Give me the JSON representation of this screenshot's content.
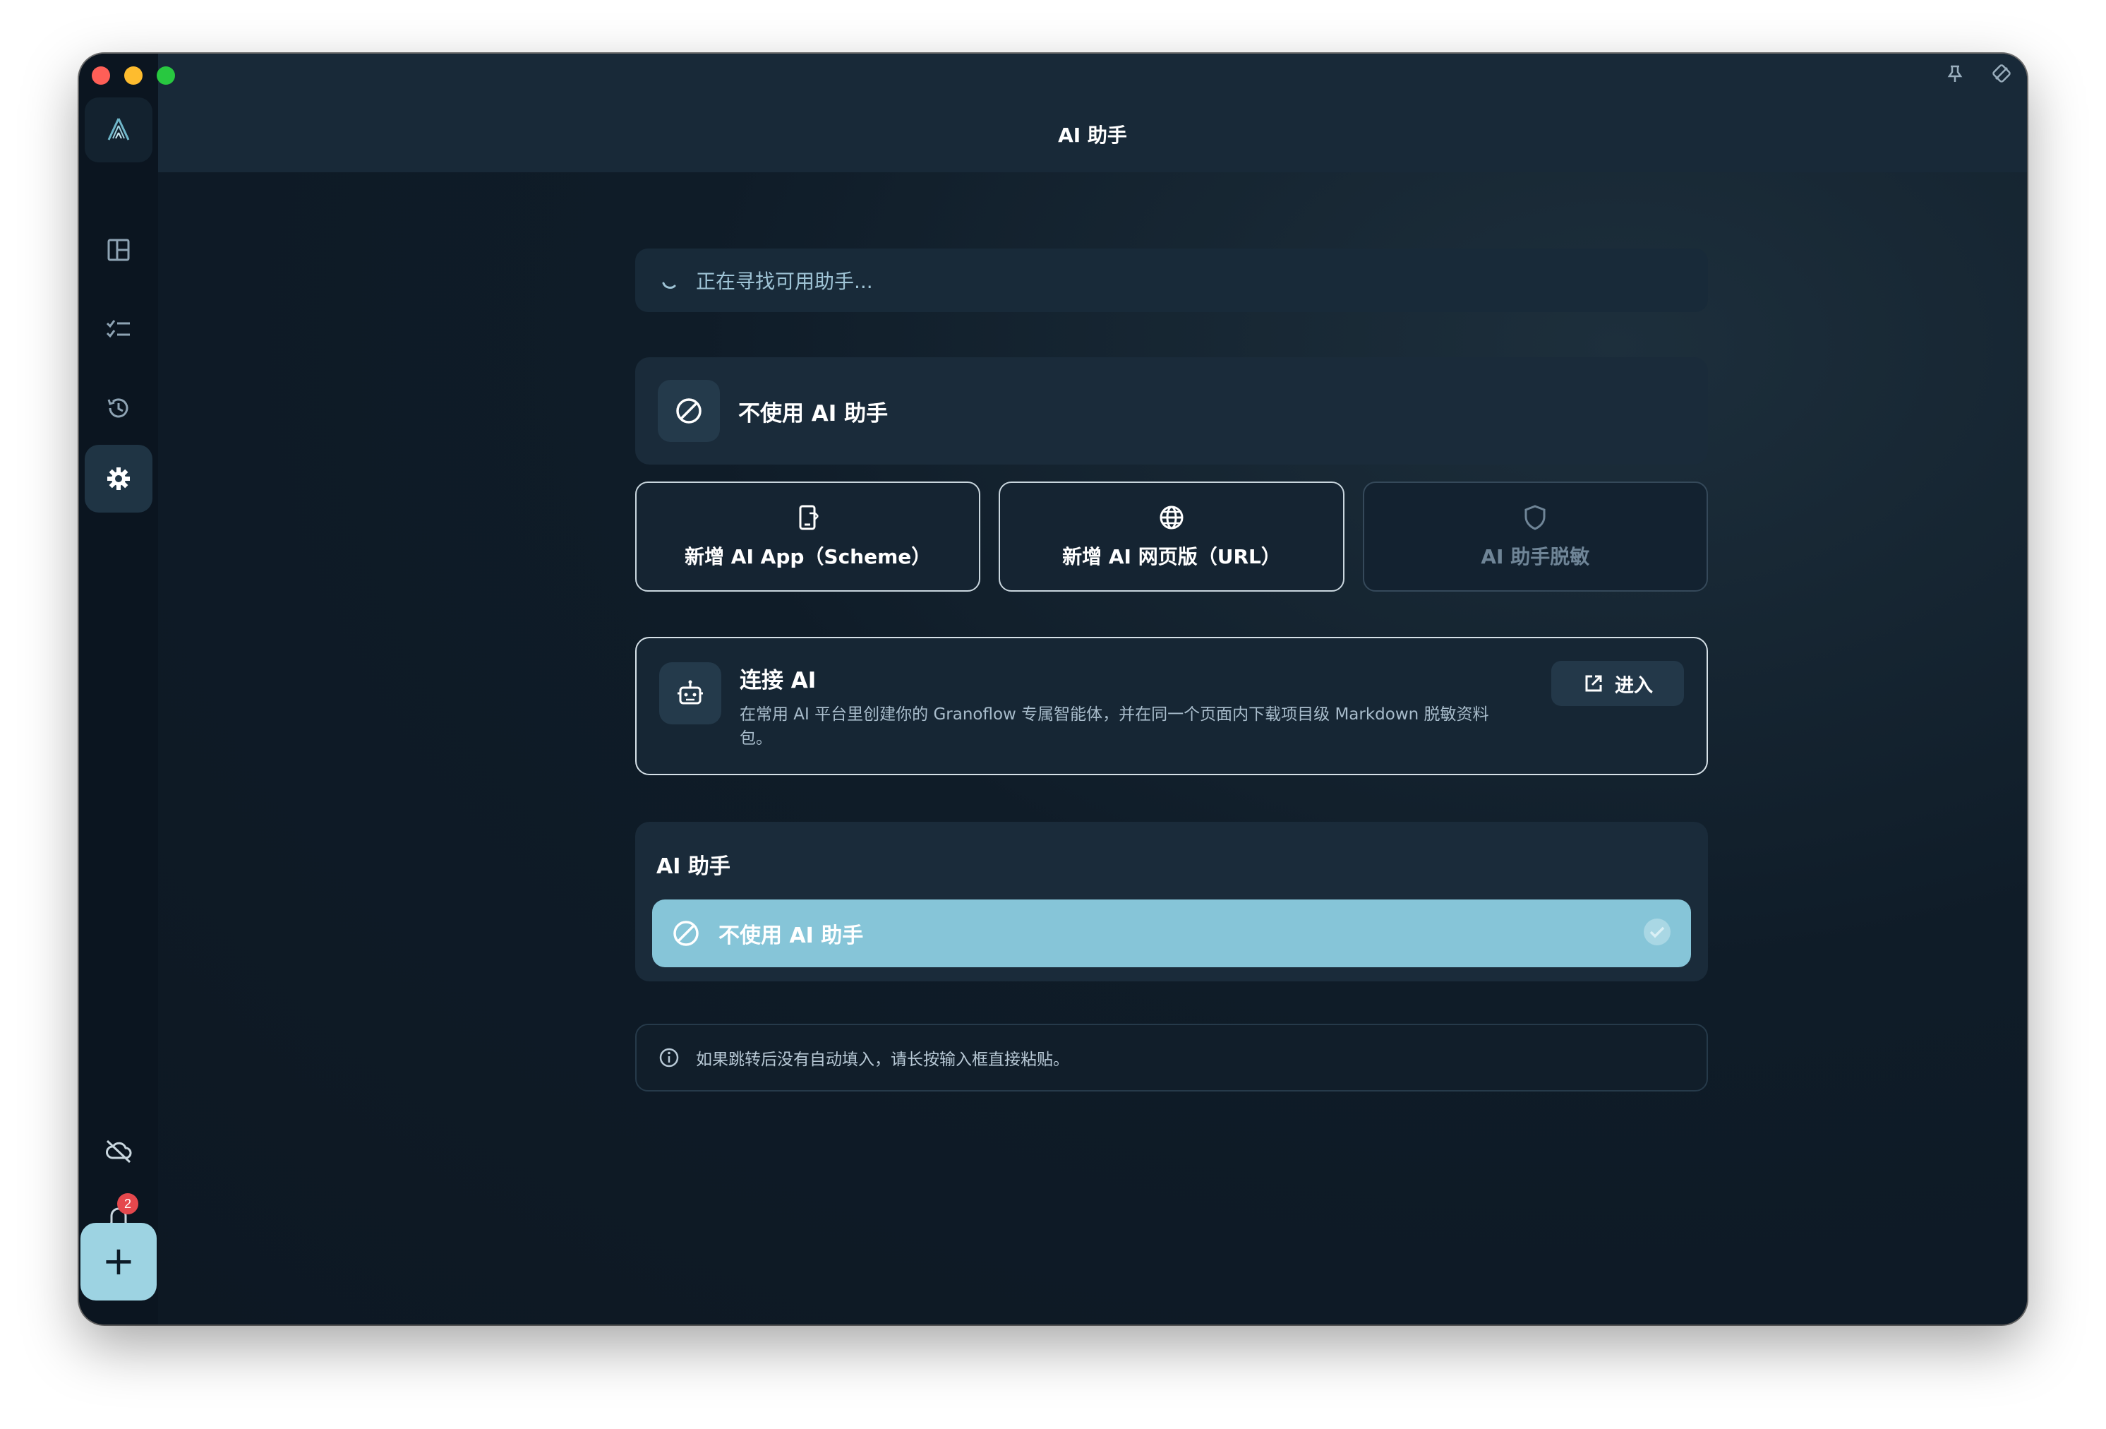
{
  "window": {
    "title": "AI 助手"
  },
  "sidebar": {
    "items": [
      {
        "name": "dashboard-icon"
      },
      {
        "name": "tasks-icon"
      },
      {
        "name": "history-icon"
      },
      {
        "name": "settings-icon",
        "active": true
      }
    ],
    "bottom": [
      {
        "name": "cloud-off-icon"
      },
      {
        "name": "bell-icon",
        "badge": "2"
      }
    ],
    "add_label": "+"
  },
  "status": {
    "searching_text": "正在寻找可用助手..."
  },
  "no_ai_card": {
    "title": "不使用 AI 助手"
  },
  "actions": [
    {
      "label": "新增 AI App（Scheme）",
      "icon": "app-add-icon",
      "enabled": true
    },
    {
      "label": "新增 AI 网页版（URL）",
      "icon": "globe-icon",
      "enabled": true
    },
    {
      "label": "AI 助手脱敏",
      "icon": "shield-icon",
      "enabled": false
    }
  ],
  "connect": {
    "title": "连接 AI",
    "description": "在常用 AI 平台里创建你的 Granoflow 专属智能体，并在同一个页面内下载项目级 Markdown 脱敏资料包。",
    "enter_label": "进入"
  },
  "helper_list": {
    "heading": "AI 助手",
    "selected_option": "不使用 AI 助手"
  },
  "info": {
    "text": "如果跳转后没有自动填入，请长按输入框直接粘贴。"
  },
  "colors": {
    "accent": "#86c5d8",
    "background": "#0f1b27",
    "card": "#1a2b3a",
    "badge": "#e5484d"
  }
}
